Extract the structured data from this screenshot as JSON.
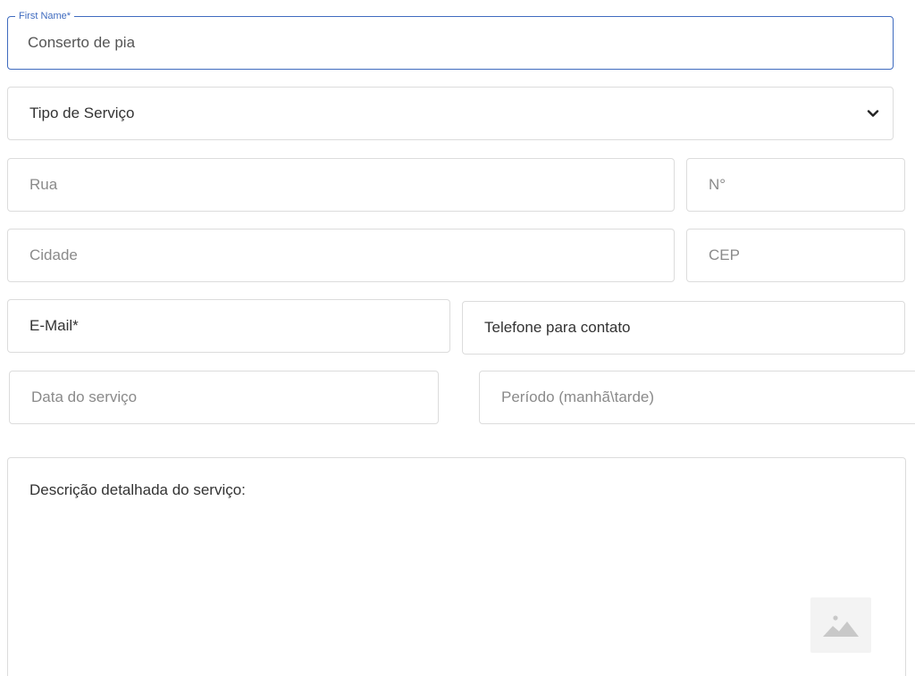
{
  "form": {
    "name_field": {
      "label": "First Name*",
      "value": "Conserto de pia"
    },
    "service_type": {
      "selected": "Tipo de Serviço"
    },
    "street": {
      "placeholder": "Rua"
    },
    "number": {
      "placeholder": "N°"
    },
    "city": {
      "placeholder": "Cidade"
    },
    "zip": {
      "placeholder": "CEP"
    },
    "email": {
      "placeholder": "E-Mail*"
    },
    "phone": {
      "placeholder": "Telefone para contato"
    },
    "service_date": {
      "placeholder": "Data do serviço"
    },
    "period": {
      "placeholder": "Período (manhã\\tarde)"
    },
    "description": {
      "label": "Descrição detalhada do serviço:"
    }
  },
  "icons": {
    "select": "chevron-down-icon",
    "image": "image-placeholder-icon"
  },
  "colors": {
    "focus_border": "#3f6bbf",
    "border": "#dcdcdc",
    "placeholder": "#8a8a8a",
    "text": "#333333"
  }
}
